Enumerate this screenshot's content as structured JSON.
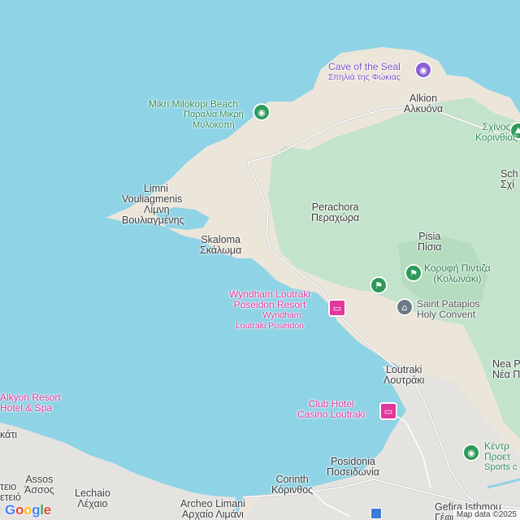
{
  "map": {
    "colors": {
      "water": "#8fd3e6",
      "land": "#ece6da",
      "forest": "#c4e3cc",
      "urban": "#e5e3e0",
      "road": "#ffffff",
      "road_outline": "#c9c9c9"
    },
    "labels": {
      "cave_of_the_seal": {
        "name": "Cave of the Seal",
        "local": "Σπηλιά της Φώκιας"
      },
      "alkion": {
        "name": "Alkion",
        "local": "Αλκυόνα"
      },
      "mikri_milokopi": {
        "name": "Mikri Milokopi Beach",
        "local1": "Παραλία Μικρή",
        "local2": "Μυλοκοπή"
      },
      "schinos": {
        "name": "Σχίνος",
        "local": "Κορινθίας"
      },
      "schinos_edge": {
        "name": "Sch",
        "local": "Σχί"
      },
      "limni": {
        "name1": "Limni",
        "name2": "Vouliagmenis",
        "local1": "Λίμνη",
        "local2": "Βουλιαγμένης"
      },
      "perachora": {
        "name": "Perachora",
        "local": "Περαχώρα"
      },
      "pisia": {
        "name": "Pisia",
        "local": "Πίσια"
      },
      "skaloma": {
        "name": "Skaloma",
        "local": "Σκάλωμα"
      },
      "koryfi": {
        "name1": "Κορυφή Πιντιζα",
        "name2": "(Κολωνάκι)"
      },
      "wyndham": {
        "name1": "Wyndham Loutraki",
        "name2": "Poseidon Resort",
        "sub1": "Wyndham",
        "sub2": "Loutraki Poseidon"
      },
      "saint_patapios": {
        "name1": "Saint Patapios",
        "name2": "Holy Convent"
      },
      "loutraki": {
        "name": "Loutraki",
        "local": "Λουτράκι"
      },
      "nea_peramos": {
        "name": "Nea P",
        "local": "Νέα Π"
      },
      "alkyon": {
        "name1": "Alkyon Resort",
        "name2": "Hotel & Spa"
      },
      "club_hotel": {
        "name1": "Club Hotel",
        "name2": "Casino Loutraki"
      },
      "kentro": {
        "name1": "Κέντρ",
        "name2": "Προετ",
        "sub": "Sports c"
      },
      "kato_edge": {
        "local": "κάτι"
      },
      "posidonia": {
        "name": "Posidonia",
        "local": "Ποσειδωνία"
      },
      "assos": {
        "name": "Assos",
        "local": "Άσσος"
      },
      "assos_edge": {
        "local1": "τειο",
        "local2": "ετειό"
      },
      "lechaio": {
        "name": "Lechaio",
        "local": "Λέχαιο"
      },
      "corinth": {
        "name": "Corinth",
        "local": "Κόρινθος"
      },
      "archeo_limani": {
        "name": "Archeo Limani",
        "local": "Αρχαίο Λιμάνι"
      },
      "gefira": {
        "name": "Gefira Isthmou",
        "local": "Γέφυρα"
      }
    },
    "icons": {
      "cave": "cave-pin-icon",
      "beach": "beach-pin-icon",
      "hotel": "bed-icon",
      "church": "church-icon",
      "hiking": "hiking-icon",
      "park": "park-icon",
      "sports": "sports-icon"
    },
    "attribution": "Map data ©2025",
    "logo": "Google"
  }
}
